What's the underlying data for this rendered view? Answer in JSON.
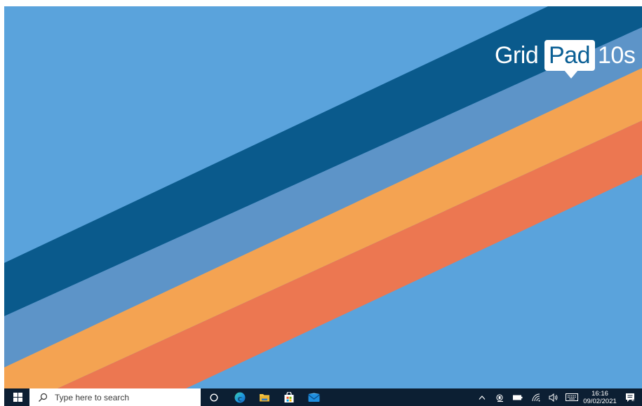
{
  "desktop": {
    "wallpaper": {
      "background_color": "#5aa3dc",
      "stripe_colors": [
        "#0a5a8c",
        "#5d94c8",
        "#f4a352",
        "#ec7751"
      ],
      "logo": {
        "word1": "Grid",
        "word2": "Pad",
        "model": "10s",
        "text_color": "#ffffff",
        "badge_color": "#ffffff"
      }
    }
  },
  "taskbar": {
    "background_color": "#0c1f33",
    "start_icon": "windows-logo-icon",
    "search": {
      "placeholder": "Type here to search",
      "icon": "search-icon"
    },
    "pinned_apps": [
      {
        "name": "Cortana",
        "icon": "cortana-circle-icon"
      },
      {
        "name": "Microsoft Edge",
        "icon": "edge-icon"
      },
      {
        "name": "File Explorer",
        "icon": "folder-icon"
      },
      {
        "name": "Microsoft Store",
        "icon": "store-bag-icon"
      },
      {
        "name": "Mail",
        "icon": "mail-icon"
      }
    ],
    "tray": {
      "icons": [
        "chevron-up-icon",
        "meet-now-icon",
        "battery-icon",
        "wifi-icon",
        "volume-icon",
        "touch-keyboard-icon"
      ],
      "time": "16:16",
      "date": "09/02/2021",
      "notification_count": "2"
    }
  }
}
